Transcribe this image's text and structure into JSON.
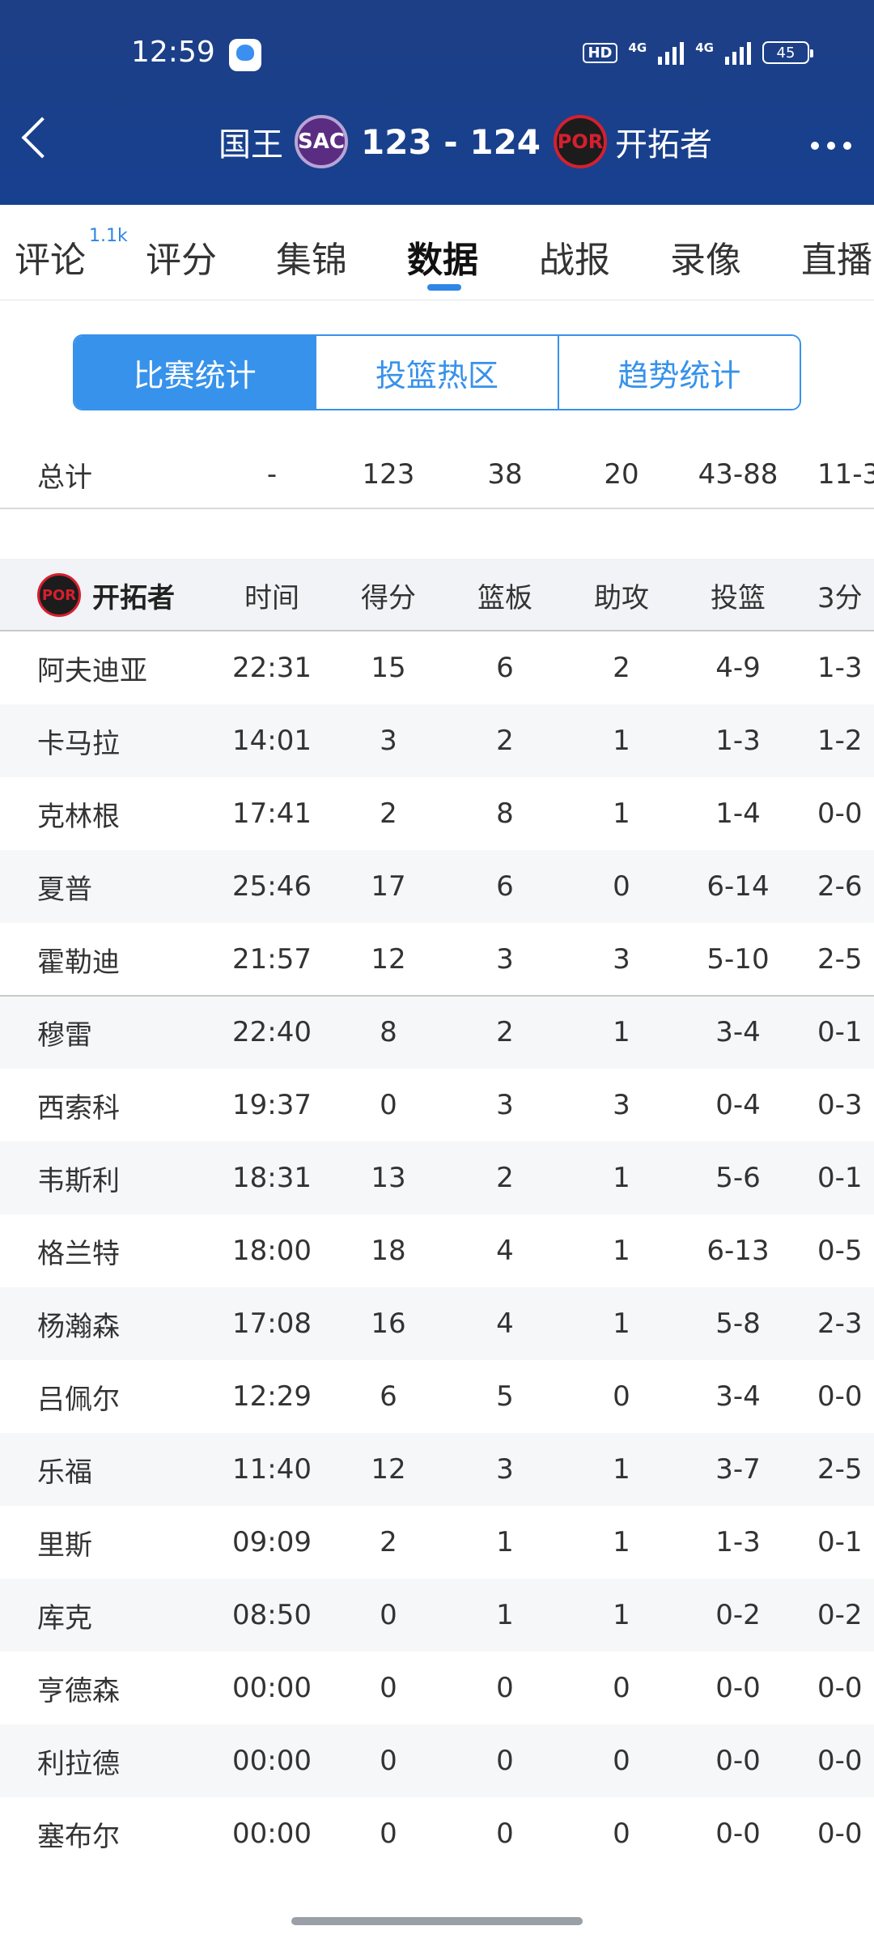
{
  "status_bar": {
    "time": "12:59",
    "hd": "HD",
    "net1": "4G",
    "net2": "4G",
    "battery": "45"
  },
  "header": {
    "home_team": "国王",
    "home_logo": "SAC",
    "score": "123 - 124",
    "away_logo": "POR",
    "away_team": "开拓者"
  },
  "tabs": [
    {
      "label": "评论",
      "badge": "1.1k"
    },
    {
      "label": "评分"
    },
    {
      "label": "集锦"
    },
    {
      "label": "数据",
      "active": true
    },
    {
      "label": "战报"
    },
    {
      "label": "录像"
    },
    {
      "label": "直播"
    }
  ],
  "segmented": [
    "比赛统计",
    "投篮热区",
    "趋势统计"
  ],
  "total_row": {
    "label": "总计",
    "min": "-",
    "pts": "123",
    "reb": "38",
    "ast": "20",
    "fg": "43-88",
    "three": "11-3"
  },
  "table": {
    "team_logo": "POR",
    "team": "开拓者",
    "headers": {
      "min": "时间",
      "pts": "得分",
      "reb": "篮板",
      "ast": "助攻",
      "fg": "投篮",
      "three": "3分"
    },
    "players": [
      {
        "name": "阿夫迪亚",
        "min": "22:31",
        "pts": "15",
        "reb": "6",
        "ast": "2",
        "fg": "4-9",
        "three": "1-3"
      },
      {
        "name": "卡马拉",
        "min": "14:01",
        "pts": "3",
        "reb": "2",
        "ast": "1",
        "fg": "1-3",
        "three": "1-2"
      },
      {
        "name": "克林根",
        "min": "17:41",
        "pts": "2",
        "reb": "8",
        "ast": "1",
        "fg": "1-4",
        "three": "0-0"
      },
      {
        "name": "夏普",
        "min": "25:46",
        "pts": "17",
        "reb": "6",
        "ast": "0",
        "fg": "6-14",
        "three": "2-6"
      },
      {
        "name": "霍勒迪",
        "min": "21:57",
        "pts": "12",
        "reb": "3",
        "ast": "3",
        "fg": "5-10",
        "three": "2-5"
      },
      {
        "name": "穆雷",
        "min": "22:40",
        "pts": "8",
        "reb": "2",
        "ast": "1",
        "fg": "3-4",
        "three": "0-1"
      },
      {
        "name": "西索科",
        "min": "19:37",
        "pts": "0",
        "reb": "3",
        "ast": "3",
        "fg": "0-4",
        "three": "0-3"
      },
      {
        "name": "韦斯利",
        "min": "18:31",
        "pts": "13",
        "reb": "2",
        "ast": "1",
        "fg": "5-6",
        "three": "0-1"
      },
      {
        "name": "格兰特",
        "min": "18:00",
        "pts": "18",
        "reb": "4",
        "ast": "1",
        "fg": "6-13",
        "three": "0-5"
      },
      {
        "name": "杨瀚森",
        "min": "17:08",
        "pts": "16",
        "reb": "4",
        "ast": "1",
        "fg": "5-8",
        "three": "2-3"
      },
      {
        "name": "吕佩尔",
        "min": "12:29",
        "pts": "6",
        "reb": "5",
        "ast": "0",
        "fg": "3-4",
        "three": "0-0"
      },
      {
        "name": "乐福",
        "min": "11:40",
        "pts": "12",
        "reb": "3",
        "ast": "1",
        "fg": "3-7",
        "three": "2-5"
      },
      {
        "name": "里斯",
        "min": "09:09",
        "pts": "2",
        "reb": "1",
        "ast": "1",
        "fg": "1-3",
        "three": "0-1"
      },
      {
        "name": "库克",
        "min": "08:50",
        "pts": "0",
        "reb": "1",
        "ast": "1",
        "fg": "0-2",
        "three": "0-2"
      },
      {
        "name": "亨德森",
        "min": "00:00",
        "pts": "0",
        "reb": "0",
        "ast": "0",
        "fg": "0-0",
        "three": "0-0"
      },
      {
        "name": "利拉德",
        "min": "00:00",
        "pts": "0",
        "reb": "0",
        "ast": "0",
        "fg": "0-0",
        "three": "0-0"
      },
      {
        "name": "塞布尔",
        "min": "00:00",
        "pts": "0",
        "reb": "0",
        "ast": "0",
        "fg": "0-0",
        "three": "0-0"
      }
    ]
  },
  "colors": {
    "header_bg": "#17408f",
    "accent": "#3792eb"
  }
}
